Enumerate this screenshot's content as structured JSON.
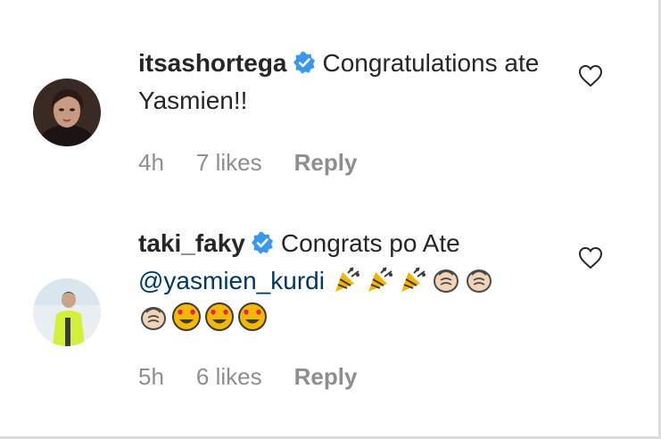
{
  "comments": [
    {
      "username": "itsashortega",
      "verified": true,
      "text": "Congratulations ate Yasmien!!",
      "mention": "",
      "emojis": [],
      "time": "4h",
      "likes": "7 likes",
      "reply_label": "Reply"
    },
    {
      "username": "taki_faky",
      "verified": true,
      "text": "Congrats po Ate",
      "mention": "@yasmien_kurdi",
      "emojis": [
        "party-popper-icon",
        "party-popper-icon",
        "party-popper-icon",
        "clapping-hands-icon",
        "clapping-hands-icon",
        "clapping-hands-icon",
        "heart-eyes-icon",
        "heart-eyes-icon",
        "heart-eyes-icon"
      ],
      "time": "5h",
      "likes": "6 likes",
      "reply_label": "Reply"
    }
  ],
  "colors": {
    "text": "#262626",
    "meta": "#8e8e8e",
    "mention": "#00376b",
    "verified": "#3897f0"
  }
}
